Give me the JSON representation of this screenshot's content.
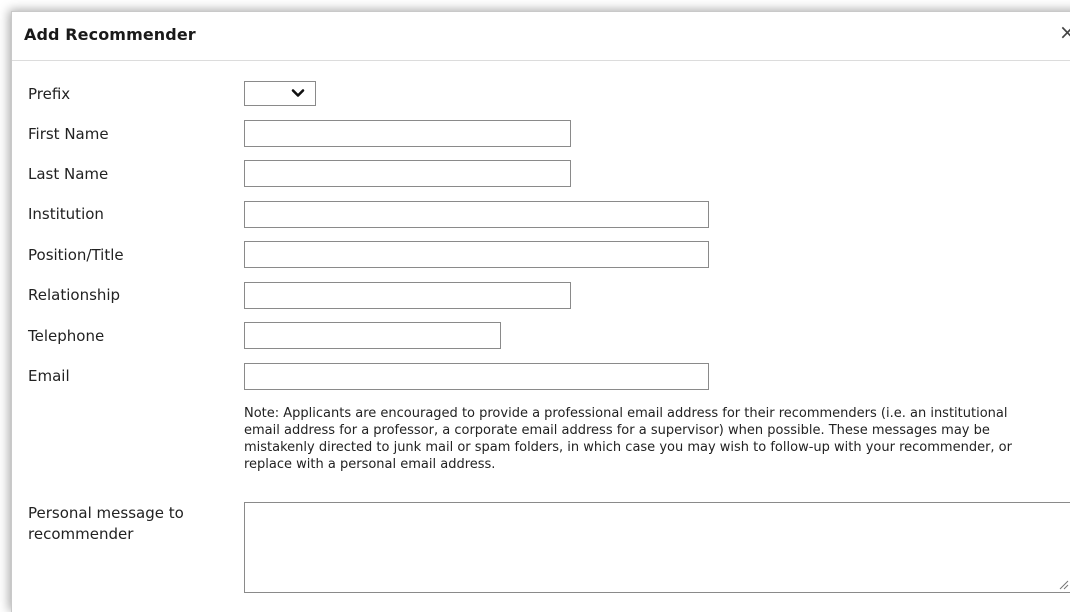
{
  "dialog": {
    "title": "Add Recommender",
    "close_symbol": "×"
  },
  "form": {
    "prefix": {
      "label": "Prefix",
      "value": ""
    },
    "first_name": {
      "label": "First Name",
      "value": ""
    },
    "last_name": {
      "label": "Last Name",
      "value": ""
    },
    "institution": {
      "label": "Institution",
      "value": ""
    },
    "position_title": {
      "label": "Position/Title",
      "value": ""
    },
    "relationship": {
      "label": "Relationship",
      "value": ""
    },
    "telephone": {
      "label": "Telephone",
      "value": ""
    },
    "email": {
      "label": "Email",
      "value": ""
    },
    "email_note": "Note: Applicants are encouraged to provide a professional email address for their recommenders (i.e. an institutional email address for a professor, a corporate email address for a supervisor) when possible. These messages may be mistakenly directed to junk mail or spam folders, in which case you may wish to follow-up with your recommender, or replace with a personal email address.",
    "personal_message": {
      "label": "Personal message to recommender",
      "value": ""
    }
  },
  "icons": {
    "select_arrow": "chevron-down-icon",
    "close": "close-icon",
    "resize": "resize-grip-icon"
  }
}
